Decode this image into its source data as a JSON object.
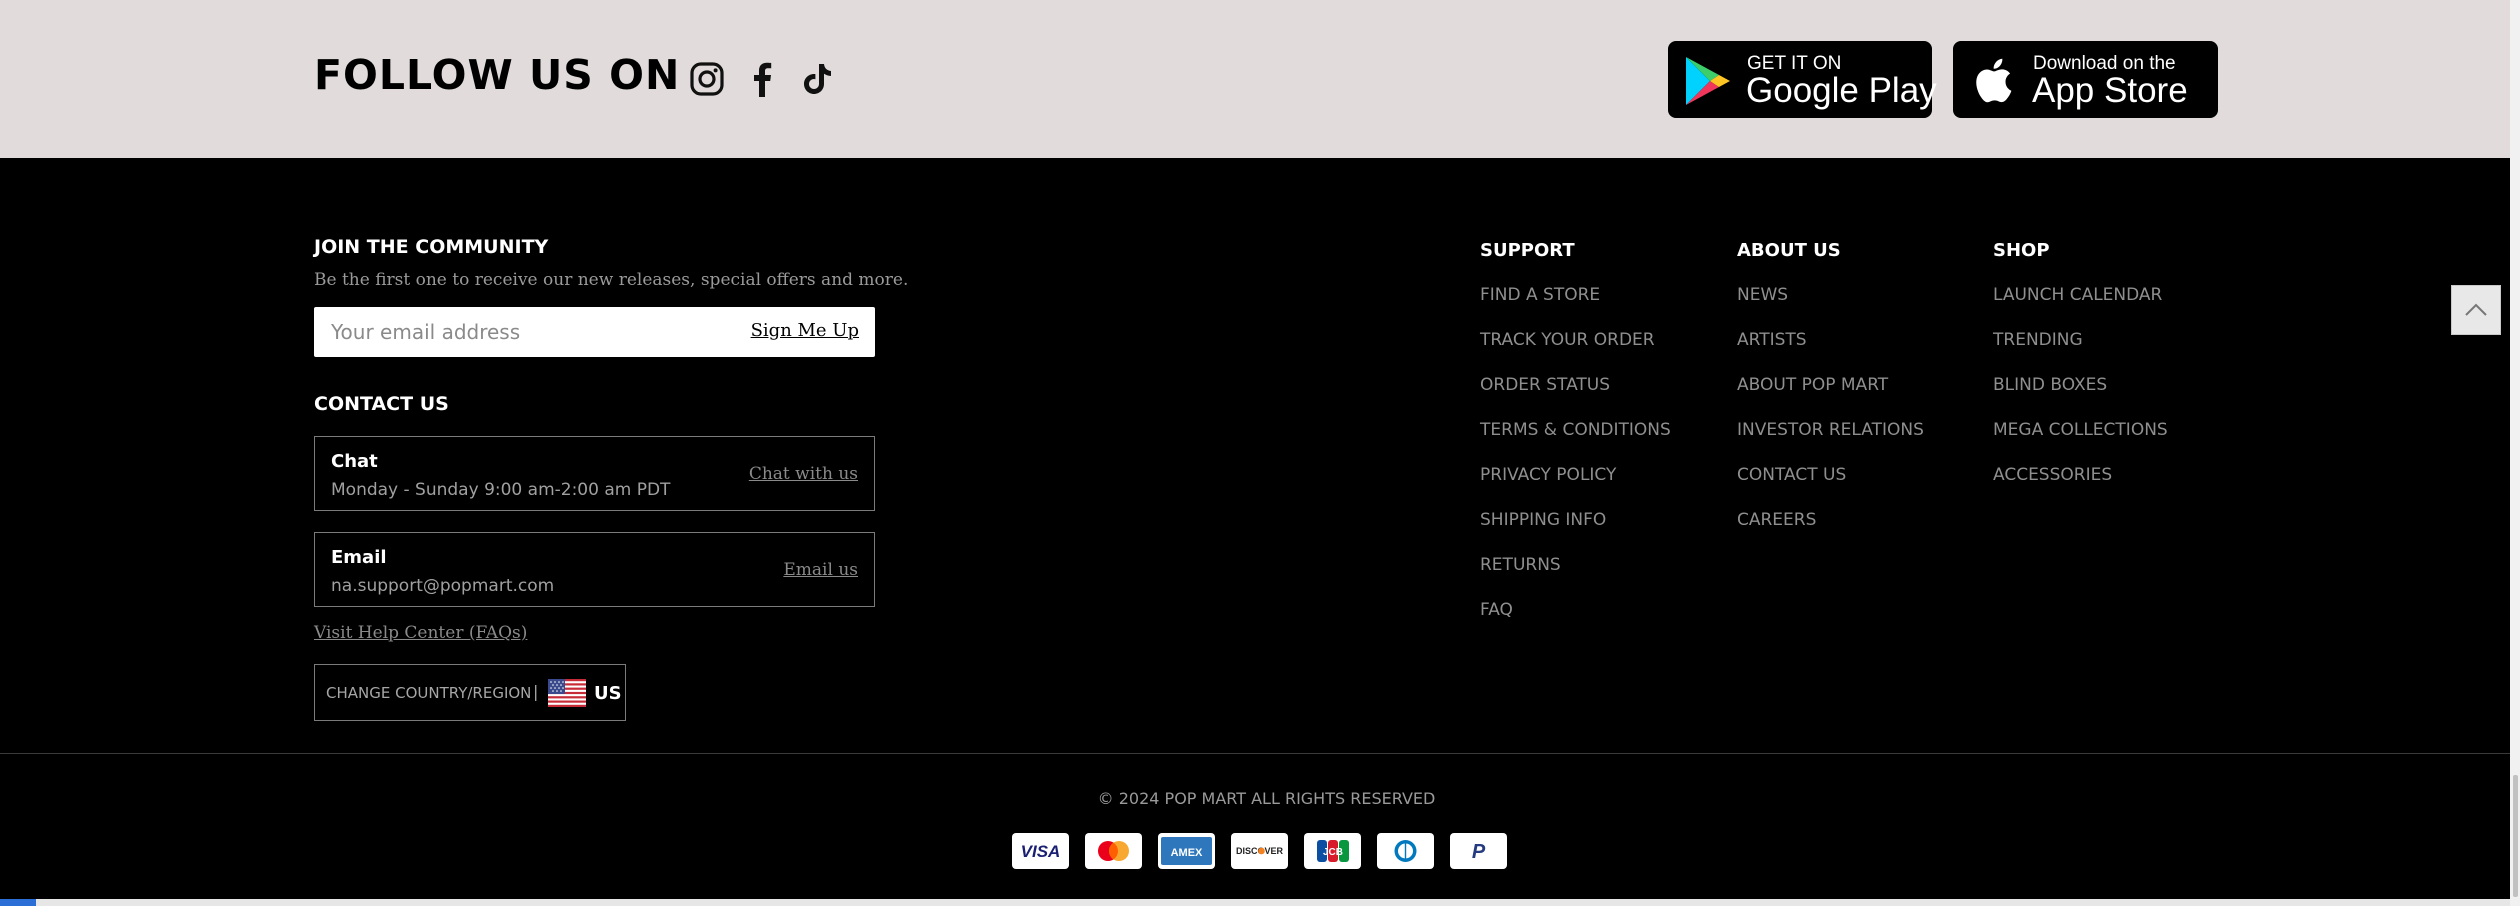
{
  "follow": {
    "title": "FOLLOW US ON",
    "social_icons": [
      "instagram-icon",
      "facebook-icon",
      "tiktok-icon"
    ],
    "google_play": {
      "small": "GET IT ON",
      "big": "Google Play"
    },
    "app_store": {
      "small": "Download on the",
      "big": "App Store"
    }
  },
  "newsletter": {
    "title": "JOIN THE COMMUNITY",
    "description": "Be the first one to receive our new releases, special offers and more.",
    "email_placeholder": "Your email address",
    "signup_label": "Sign Me Up"
  },
  "contact": {
    "title": "CONTACT US",
    "chat": {
      "title": "Chat",
      "detail": "Monday - Sunday 9:00 am-2:00 am PDT",
      "link": "Chat with us"
    },
    "email": {
      "title": "Email",
      "detail": "na.support@popmart.com",
      "link": "Email us"
    },
    "help_link": "Visit Help Center (FAQs)",
    "region": {
      "label": "CHANGE COUNTRY/REGION",
      "separator": "|",
      "code": "US",
      "flag_icon": "us-flag-icon"
    }
  },
  "columns": {
    "support": {
      "title": "SUPPORT",
      "items": [
        "FIND A STORE",
        "TRACK YOUR ORDER",
        "ORDER STATUS",
        "TERMS & CONDITIONS",
        "PRIVACY POLICY",
        "SHIPPING INFO",
        "RETURNS",
        "FAQ"
      ]
    },
    "about": {
      "title": "ABOUT US",
      "items": [
        "NEWS",
        "ARTISTS",
        "ABOUT POP MART",
        "INVESTOR RELATIONS",
        "CONTACT US",
        "CAREERS"
      ]
    },
    "shop": {
      "title": "SHOP",
      "items": [
        "LAUNCH CALENDAR",
        "TRENDING",
        "BLIND BOXES",
        "MEGA COLLECTIONS",
        "ACCESSORIES"
      ]
    }
  },
  "back_to_top_icon": "chevron-up-icon",
  "copyright": "© 2024 POP MART ALL RIGHTS RESERVED",
  "payments": {
    "visa": "VISA",
    "amex": "AMEX",
    "discover": "DISCOVER",
    "jcb": "JCB",
    "paypal": "P",
    "icons": [
      "visa-icon",
      "mastercard-icon",
      "amex-icon",
      "discover-icon",
      "jcb-icon",
      "diners-club-icon",
      "paypal-icon"
    ]
  },
  "colors": {
    "follow_bg": "#e1dcdb",
    "footer_bg": "#000000",
    "link_gray": "#8f8f8f"
  }
}
